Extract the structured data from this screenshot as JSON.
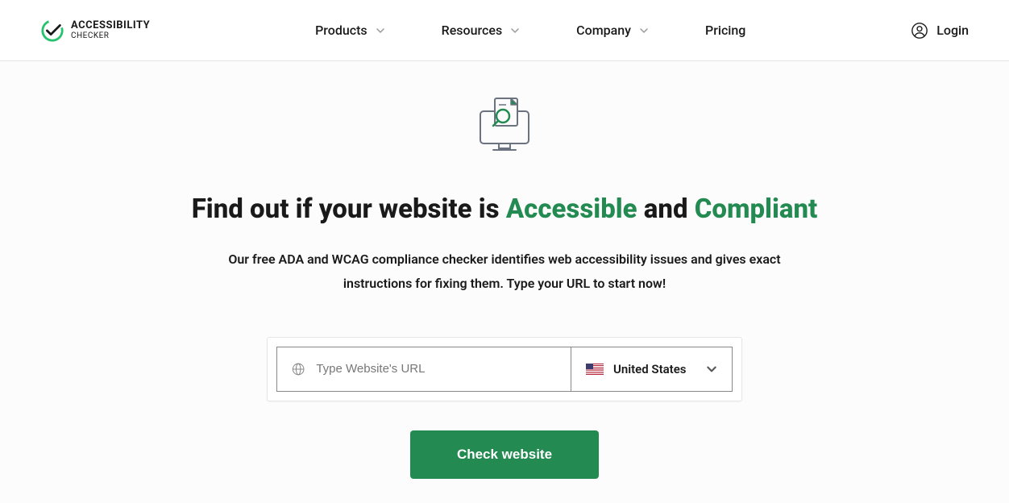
{
  "logo": {
    "line1": "ACCESSIBILITY",
    "line2": "CHECKER"
  },
  "nav": {
    "products": "Products",
    "resources": "Resources",
    "company": "Company",
    "pricing": "Pricing"
  },
  "login": "Login",
  "hero": {
    "title_prefix": "Find out if your website is ",
    "title_accent1": "Accessible",
    "title_mid": " and ",
    "title_accent2": "Compliant",
    "desc": "Our free ADA and WCAG compliance checker identifies web accessibility issues and gives exact instructions for fixing them. Type your URL to start now!"
  },
  "form": {
    "url_placeholder": "Type Website's URL",
    "country_selected": "United States",
    "submit_label": "Check website"
  }
}
